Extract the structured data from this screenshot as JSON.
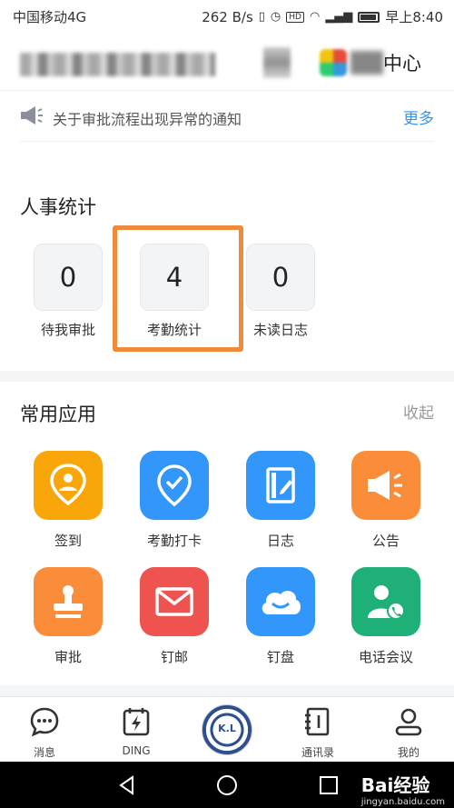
{
  "status": {
    "carrier": "中国移动4G",
    "speed": "262 B/s",
    "time": "早上8:40"
  },
  "header": {
    "title": "中心"
  },
  "notice": {
    "text": "关于审批流程出现异常的通知",
    "more": "更多"
  },
  "hr": {
    "title": "人事统计",
    "stats": [
      {
        "value": "0",
        "label": "待我审批"
      },
      {
        "value": "4",
        "label": "考勤统计"
      },
      {
        "value": "0",
        "label": "未读日志"
      }
    ]
  },
  "apps": {
    "title": "常用应用",
    "collapse": "收起",
    "items": [
      {
        "label": "签到",
        "color": "#f9a60a",
        "icon": "location-pin-icon"
      },
      {
        "label": "考勤打卡",
        "color": "#3296fa",
        "icon": "location-check-icon"
      },
      {
        "label": "日志",
        "color": "#3296fa",
        "icon": "journal-icon"
      },
      {
        "label": "公告",
        "color": "#fb8c3a",
        "icon": "megaphone-icon"
      },
      {
        "label": "审批",
        "color": "#fb8c3a",
        "icon": "stamp-icon"
      },
      {
        "label": "钉邮",
        "color": "#ef5350",
        "icon": "mail-icon"
      },
      {
        "label": "钉盘",
        "color": "#3296fa",
        "icon": "cloud-icon"
      },
      {
        "label": "电话会议",
        "color": "#1fb07a",
        "icon": "phone-meeting-icon"
      }
    ]
  },
  "tabs": [
    {
      "label": "消息",
      "icon": "chat-bubble-icon"
    },
    {
      "label": "DING",
      "icon": "ding-bolt-icon"
    },
    {
      "label": "通讯录",
      "icon": "contacts-icon"
    },
    {
      "label": "我的",
      "icon": "user-icon"
    }
  ],
  "watermark": {
    "main": "Bai经验",
    "sub": "jingyan.baidu.com"
  },
  "logo": {
    "text": "K.L"
  }
}
